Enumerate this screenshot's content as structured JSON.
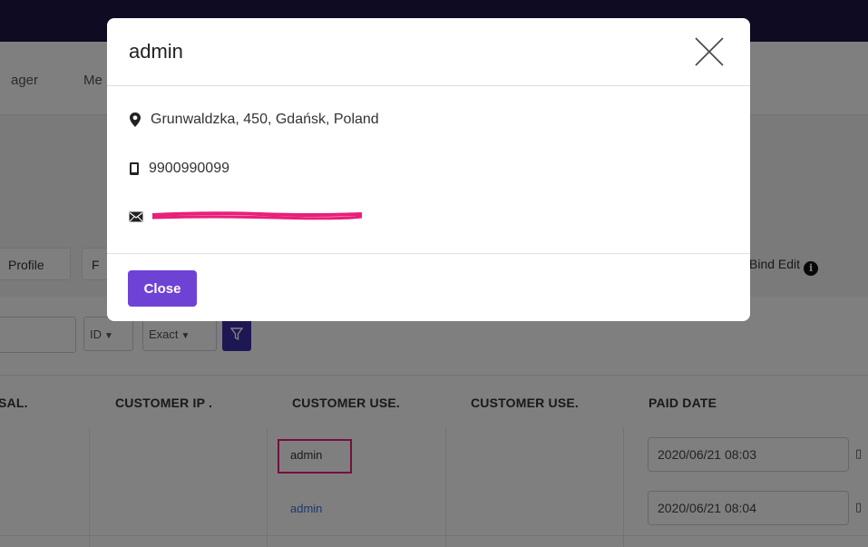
{
  "background": {
    "nav": {
      "items": [
        "ager",
        "Me"
      ]
    },
    "toolbar": {
      "profile_label": "Profile",
      "f_label": "F",
      "bind_edit_label": "Bind Edit",
      "info_glyph": "i"
    },
    "filters": {
      "id_select": "ID",
      "match_select": "Exact"
    },
    "table": {
      "headers": [
        "SAL.",
        "CUSTOMER IP .",
        "CUSTOMER USE.",
        "CUSTOMER USE.",
        "PAID DATE"
      ],
      "rows": [
        {
          "customer_user": "admin",
          "paid_date": "2020/06/21 08:03"
        },
        {
          "customer_user": "admin",
          "paid_date": "2020/06/21 08:04"
        }
      ]
    }
  },
  "modal": {
    "title": "admin",
    "address": "Grunwaldzka, 450, Gdańsk, Poland",
    "phone": "9900990099",
    "close_label": "Close"
  },
  "colors": {
    "topbar": "#1e1744",
    "accent": "#6f42d6",
    "filter_button": "#3b31a8",
    "highlight": "#e8207a",
    "link": "#3a6fd8"
  },
  "icons": {
    "address": "map-marker-icon",
    "phone": "mobile-phone-icon",
    "email": "envelope-icon",
    "close": "close-icon",
    "filter": "filter-icon",
    "info": "info-icon"
  }
}
